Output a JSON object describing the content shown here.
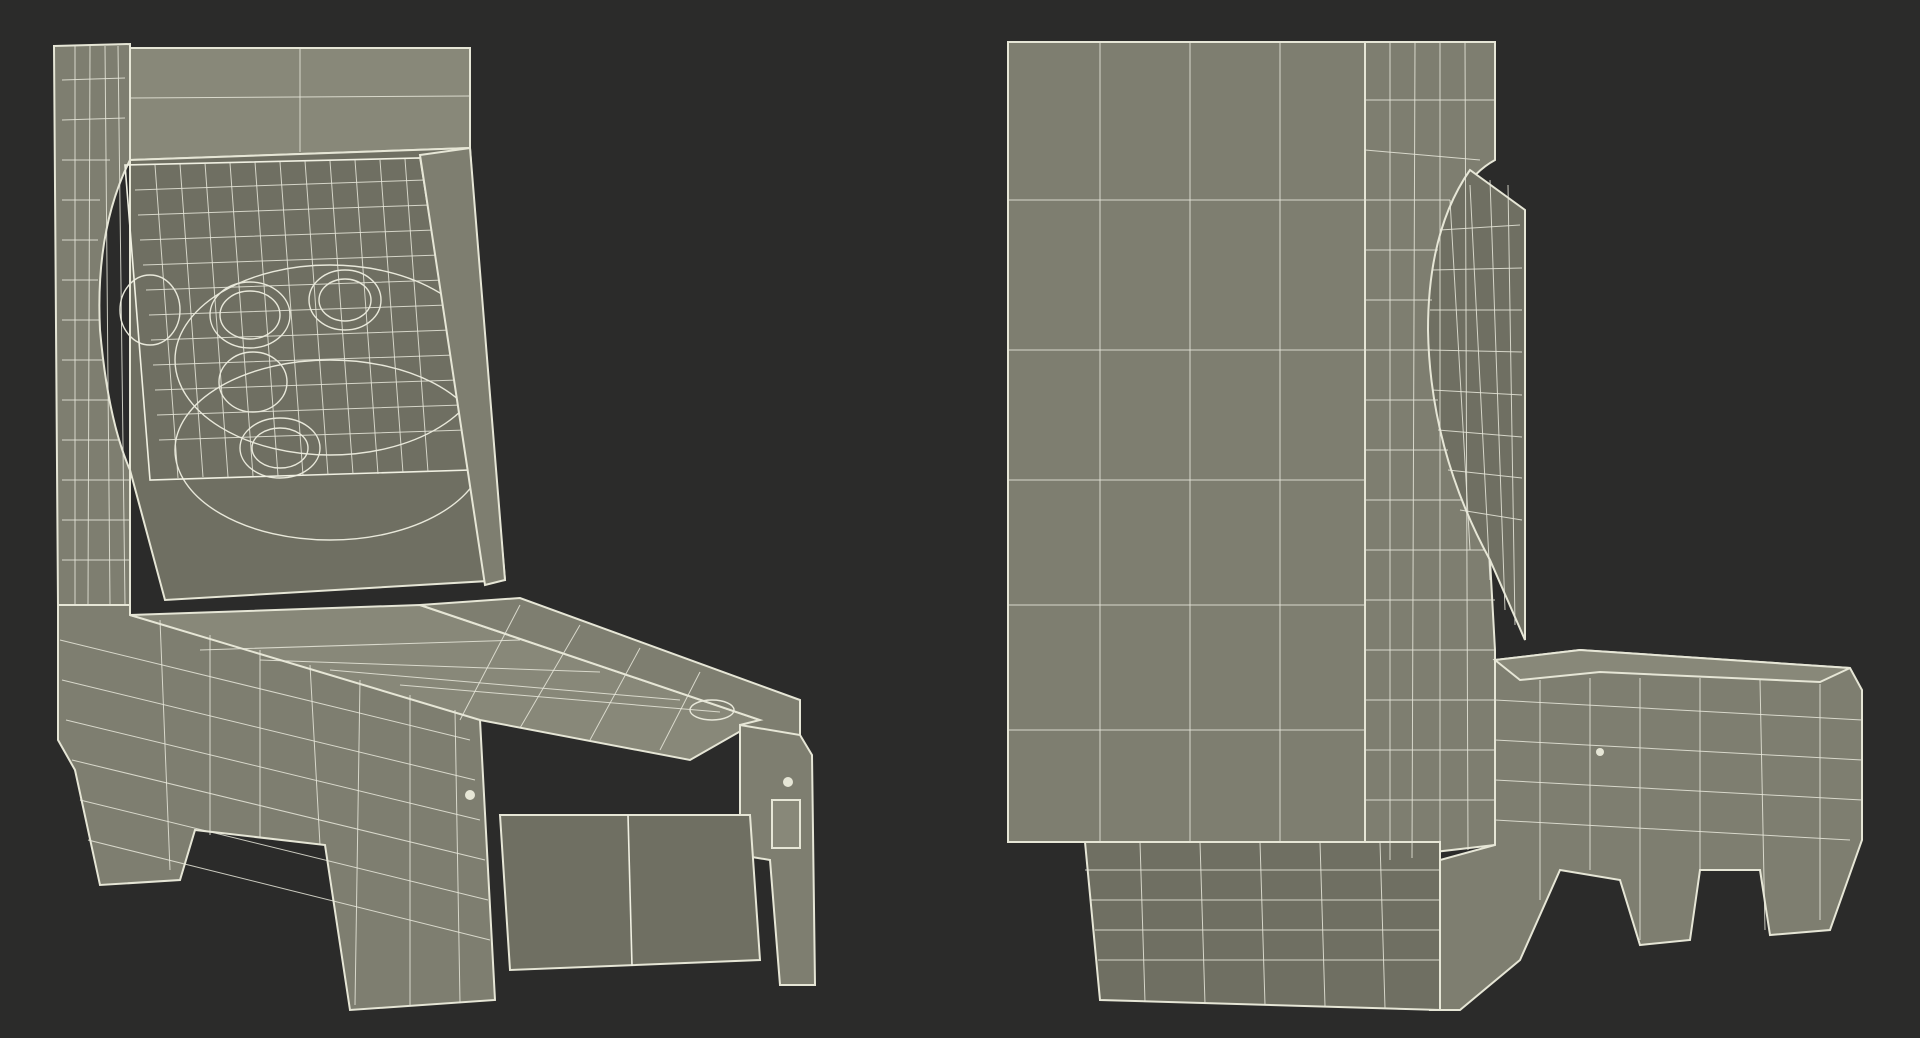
{
  "scene": {
    "background": "#2b2b2a",
    "model_fill": "#7e7e70",
    "wire_color": "#e6e6d6",
    "views": [
      {
        "view": "front-three-quarter"
      },
      {
        "view": "rear-side"
      }
    ]
  }
}
